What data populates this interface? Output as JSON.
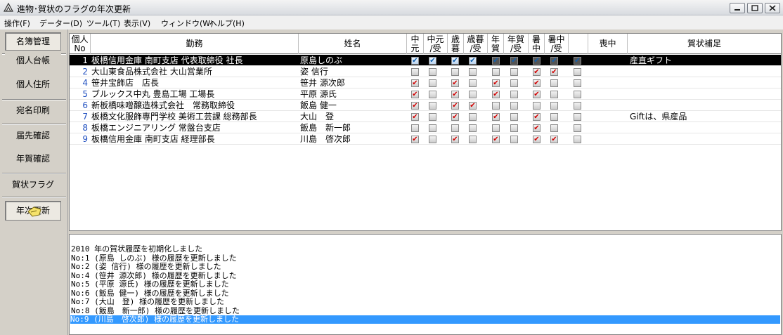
{
  "window": {
    "title": "進物･賀状のフラグの年次更新"
  },
  "menu": [
    "操作(F)",
    "データー(D)",
    "ツール(T)",
    "表示(V)",
    "ウィンドウ(W)",
    "ヘルプ(H)"
  ],
  "sidebar": [
    "名簿管理",
    "個人台帳",
    "個人住所",
    "宛名印刷",
    "届先確認",
    "年賀確認",
    "賀状フラグ",
    "年次更新"
  ],
  "columns": {
    "no": "個人No",
    "work": "勤務",
    "name": "姓名",
    "flags": [
      "中元",
      "中元/受",
      "歳暮",
      "歳暮/受",
      "年賀",
      "年賀/受",
      "暑中",
      "暑中/受"
    ],
    "mourn": "喪中",
    "note": "賀状補足"
  },
  "rows": [
    {
      "no": "1",
      "work": "板橋信用金庫 南町支店 代表取締役 社長",
      "name": "原島しのぶ",
      "flags": [
        true,
        true,
        true,
        true,
        false,
        false,
        false,
        false
      ],
      "mourn": false,
      "note": "産直ギフト",
      "selected": true
    },
    {
      "no": "2",
      "work": "大山東食品株式会社 大山営業所",
      "name": "姿 信行",
      "flags": [
        false,
        false,
        false,
        false,
        false,
        false,
        true,
        true
      ],
      "mourn": false,
      "note": ""
    },
    {
      "no": "4",
      "work": "笹井宝飾店　店長",
      "name": "笹井 源次郎",
      "flags": [
        true,
        false,
        true,
        false,
        true,
        false,
        true,
        false
      ],
      "mourn": false,
      "note": ""
    },
    {
      "no": "5",
      "work": "ブルックス中丸 豊島工場 工場長",
      "name": "平原 源氏",
      "flags": [
        true,
        false,
        true,
        false,
        true,
        false,
        true,
        false
      ],
      "mourn": false,
      "note": ""
    },
    {
      "no": "6",
      "work": "新板橋味噌醸造株式会社　常務取締役",
      "name": "飯島 健一",
      "flags": [
        true,
        false,
        true,
        true,
        false,
        false,
        false,
        false
      ],
      "mourn": false,
      "note": ""
    },
    {
      "no": "7",
      "work": "板橋文化服飾専門学校 美術工芸課 総務部長",
      "name": "大山　登",
      "flags": [
        true,
        false,
        true,
        false,
        true,
        false,
        true,
        false
      ],
      "mourn": false,
      "note": "Giftは、県産品"
    },
    {
      "no": "8",
      "work": "板橋エンジニアリング 常盤台支店",
      "name": "飯島　新一郎",
      "flags": [
        false,
        false,
        false,
        false,
        false,
        false,
        true,
        false
      ],
      "mourn": false,
      "note": ""
    },
    {
      "no": "9",
      "work": "板橋信用金庫 南町支店 経理部長",
      "name": "川島　啓次郎",
      "flags": [
        true,
        false,
        true,
        false,
        true,
        false,
        true,
        true
      ],
      "mourn": false,
      "note": ""
    }
  ],
  "log": [
    "2010 年の賀状履歴を初期化しました",
    "No:1 (原島 しのぶ) 様の履歴を更新しました",
    "No:2 (姿 信行) 様の履歴を更新しました",
    "No:4 (笹井 源次郎) 様の履歴を更新しました",
    "No:5 (平原 源氏) 様の履歴を更新しました",
    "No:6 (飯島 健一) 様の履歴を更新しました",
    "No:7 (大山　登) 様の履歴を更新しました",
    "No:8 (飯島　新一郎) 様の履歴を更新しました",
    "No:9 (川島　啓次郎) 様の履歴を更新しました"
  ]
}
